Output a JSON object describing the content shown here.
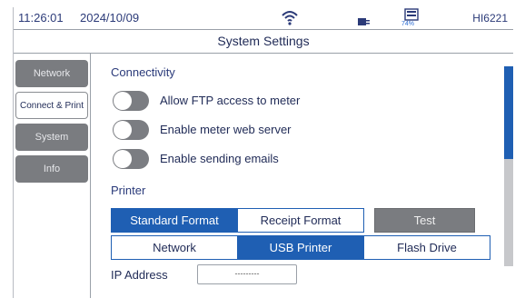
{
  "status": {
    "time": "11:26:01",
    "date": "2024/10/09",
    "battery_pct": "74%",
    "model": "HI6221",
    "icons": [
      "wifi-icon",
      "plug-icon",
      "battery-icon"
    ]
  },
  "title": "System Settings",
  "sidebar": {
    "items": [
      {
        "label": "Network",
        "active": false
      },
      {
        "label": "Connect & Print",
        "active": true
      },
      {
        "label": "System",
        "active": false
      },
      {
        "label": "Info",
        "active": false
      }
    ]
  },
  "connectivity": {
    "heading": "Connectivity",
    "toggles": [
      {
        "label": "Allow FTP access to meter",
        "on": false
      },
      {
        "label": "Enable meter web server",
        "on": false
      },
      {
        "label": "Enable sending emails",
        "on": false
      }
    ]
  },
  "printer": {
    "heading": "Printer",
    "format_tabs": [
      {
        "label": "Standard Format",
        "selected": true
      },
      {
        "label": "Receipt Format",
        "selected": false
      }
    ],
    "test_label": "Test",
    "output_tabs": [
      {
        "label": "Network",
        "selected": false
      },
      {
        "label": "USB Printer",
        "selected": true
      },
      {
        "label": "Flash Drive",
        "selected": false
      }
    ]
  },
  "ip": {
    "label": "IP Address",
    "value": "---------"
  },
  "colors": {
    "accent": "#1f5fb3",
    "inactive_grey": "#7a7c80",
    "text": "#1f2a56"
  },
  "scroll": {
    "position_fraction": 0
  }
}
